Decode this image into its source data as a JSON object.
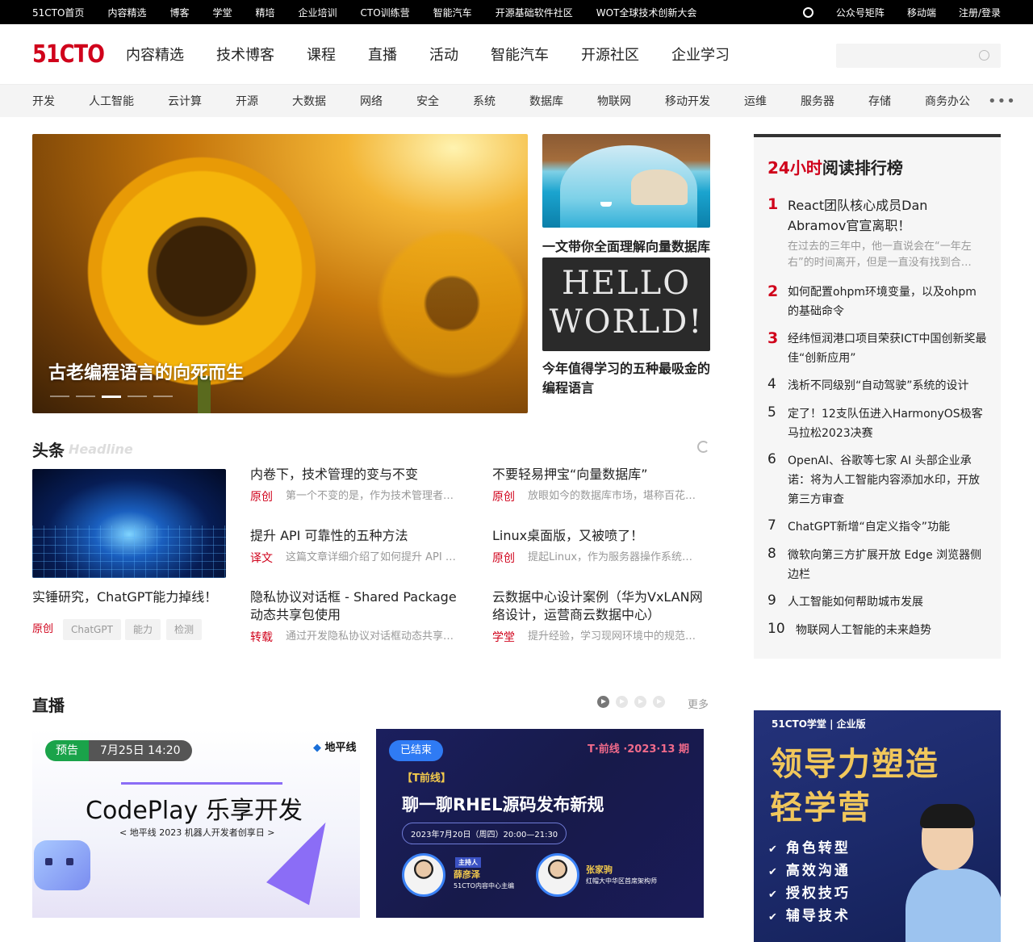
{
  "topbar": {
    "left": [
      "51CTO首页",
      "内容精选",
      "博客",
      "学堂",
      "精培",
      "企业培训",
      "CTO训练营",
      "智能汽车",
      "开源基础软件社区",
      "WOT全球技术创新大会"
    ],
    "right": [
      "公众号矩阵",
      "移动端",
      "注册/登录"
    ]
  },
  "header": {
    "logo": "51CTO",
    "nav": [
      "内容精选",
      "技术博客",
      "课程",
      "直播",
      "活动",
      "智能汽车",
      "开源社区",
      "企业学习"
    ],
    "search_placeholder": ""
  },
  "categories": [
    "开发",
    "人工智能",
    "云计算",
    "开源",
    "大数据",
    "网络",
    "安全",
    "系统",
    "数据库",
    "物联网",
    "移动开发",
    "运维",
    "服务器",
    "存储",
    "商务办公"
  ],
  "hero": {
    "caption": "古老编程语言的向死而生",
    "slides": 5,
    "active_slide": 3
  },
  "side_articles": [
    {
      "caption": "一文带你全面理解向量数据库"
    },
    {
      "caption": "今年值得学习的五种最吸金的编程语言",
      "image_text": "HELLO WORLD!"
    }
  ],
  "ranking": {
    "title_red": "24小时",
    "title_rest": "阅读排行榜",
    "items": [
      {
        "num": "1",
        "title": "React团队核心成员Dan Abramov官宣离职！",
        "desc": "在过去的三年中，他一直说会在“一年左右”的时间离开，但是一直没有找到合…"
      },
      {
        "num": "2",
        "title": "如何配置ohpm环境变量，以及ohpm的基础命令"
      },
      {
        "num": "3",
        "title": "经纬恒润港口项目荣获ICT中国创新奖最佳“创新应用”"
      },
      {
        "num": "4",
        "title": "浅析不同级别“自动驾驶”系统的设计"
      },
      {
        "num": "5",
        "title": "定了！12支队伍进入HarmonyOS极客马拉松2023决赛"
      },
      {
        "num": "6",
        "title": "OpenAI、谷歌等七家 AI 头部企业承诺：将为人工智能内容添加水印，开放第三方审查"
      },
      {
        "num": "7",
        "title": "ChatGPT新增“自定义指令”功能"
      },
      {
        "num": "8",
        "title": "微软向第三方扩展开放 Edge 浏览器侧边栏"
      },
      {
        "num": "9",
        "title": "人工智能如何帮助城市发展"
      },
      {
        "num": "10",
        "title": "物联网人工智能的未来趋势"
      }
    ]
  },
  "headline": {
    "title": "头条",
    "title_en": "Headline",
    "feature": {
      "caption": "实锤研究，ChatGPT能力掉线！",
      "label": "原创",
      "tags": [
        "ChatGPT",
        "能力",
        "检测"
      ]
    },
    "articles": [
      {
        "title": "内卷下，技术管理的变与不变",
        "label": "原创",
        "desc": "第一个不变的是，作为技术管理者…"
      },
      {
        "title": "不要轻易押宝“向量数据库”",
        "label": "原创",
        "desc": "放眼如今的数据库市场，堪称百花…"
      },
      {
        "title": "提升 API 可靠性的五种方法",
        "label": "译文",
        "desc": "这篇文章详细介绍了如何提升 API …"
      },
      {
        "title": "Linux桌面版，又被喷了！",
        "label": "原创",
        "desc": "提起Linux，作为服务器操作系统…"
      },
      {
        "title": "隐私协议对话框 - Shared Package动态共享包使用",
        "label": "转载",
        "desc": "通过开发隐私协议对话框动态共享…"
      },
      {
        "title": "云数据中心设计案例（华为VxLAN网络设计，运营商云数据中心）",
        "label": "学堂",
        "desc": "提升经验，学习现网环境中的规范…"
      }
    ]
  },
  "live": {
    "title": "直播",
    "more": "更多",
    "cards": [
      {
        "status": "预告",
        "time": "7月25日 14:20",
        "brand": "地平线",
        "headline_en": "CodePlay",
        "headline_cn": "乐享开发",
        "subtitle": "< 地平线 2023 机器人开发者创享日 >"
      },
      {
        "status": "已结束",
        "series": "T·前线 ·2023·13 期",
        "tag": "【T前线】",
        "headline": "聊一聊RHEL源码发布新规",
        "datetime": "2023年7月20日（周四）20:00—21:30",
        "host_role": "主持人",
        "host_name": "薛彦泽",
        "host_desc": "51CTO内容中心主编",
        "guest_name": "张家驹",
        "guest_desc": "红帽大中华区首席架构师"
      }
    ]
  },
  "ad": {
    "brand": "51CTO学堂 | 企业版",
    "title1": "领导力塑造",
    "title2": "轻学营",
    "points": [
      "角色转型",
      "高效沟通",
      "授权技巧",
      "辅导技术"
    ]
  },
  "colors": {
    "accent": "#d0021b",
    "topbar": "#000000",
    "live_green": "#1aa34a",
    "live_blue": "#2f7bf4"
  }
}
